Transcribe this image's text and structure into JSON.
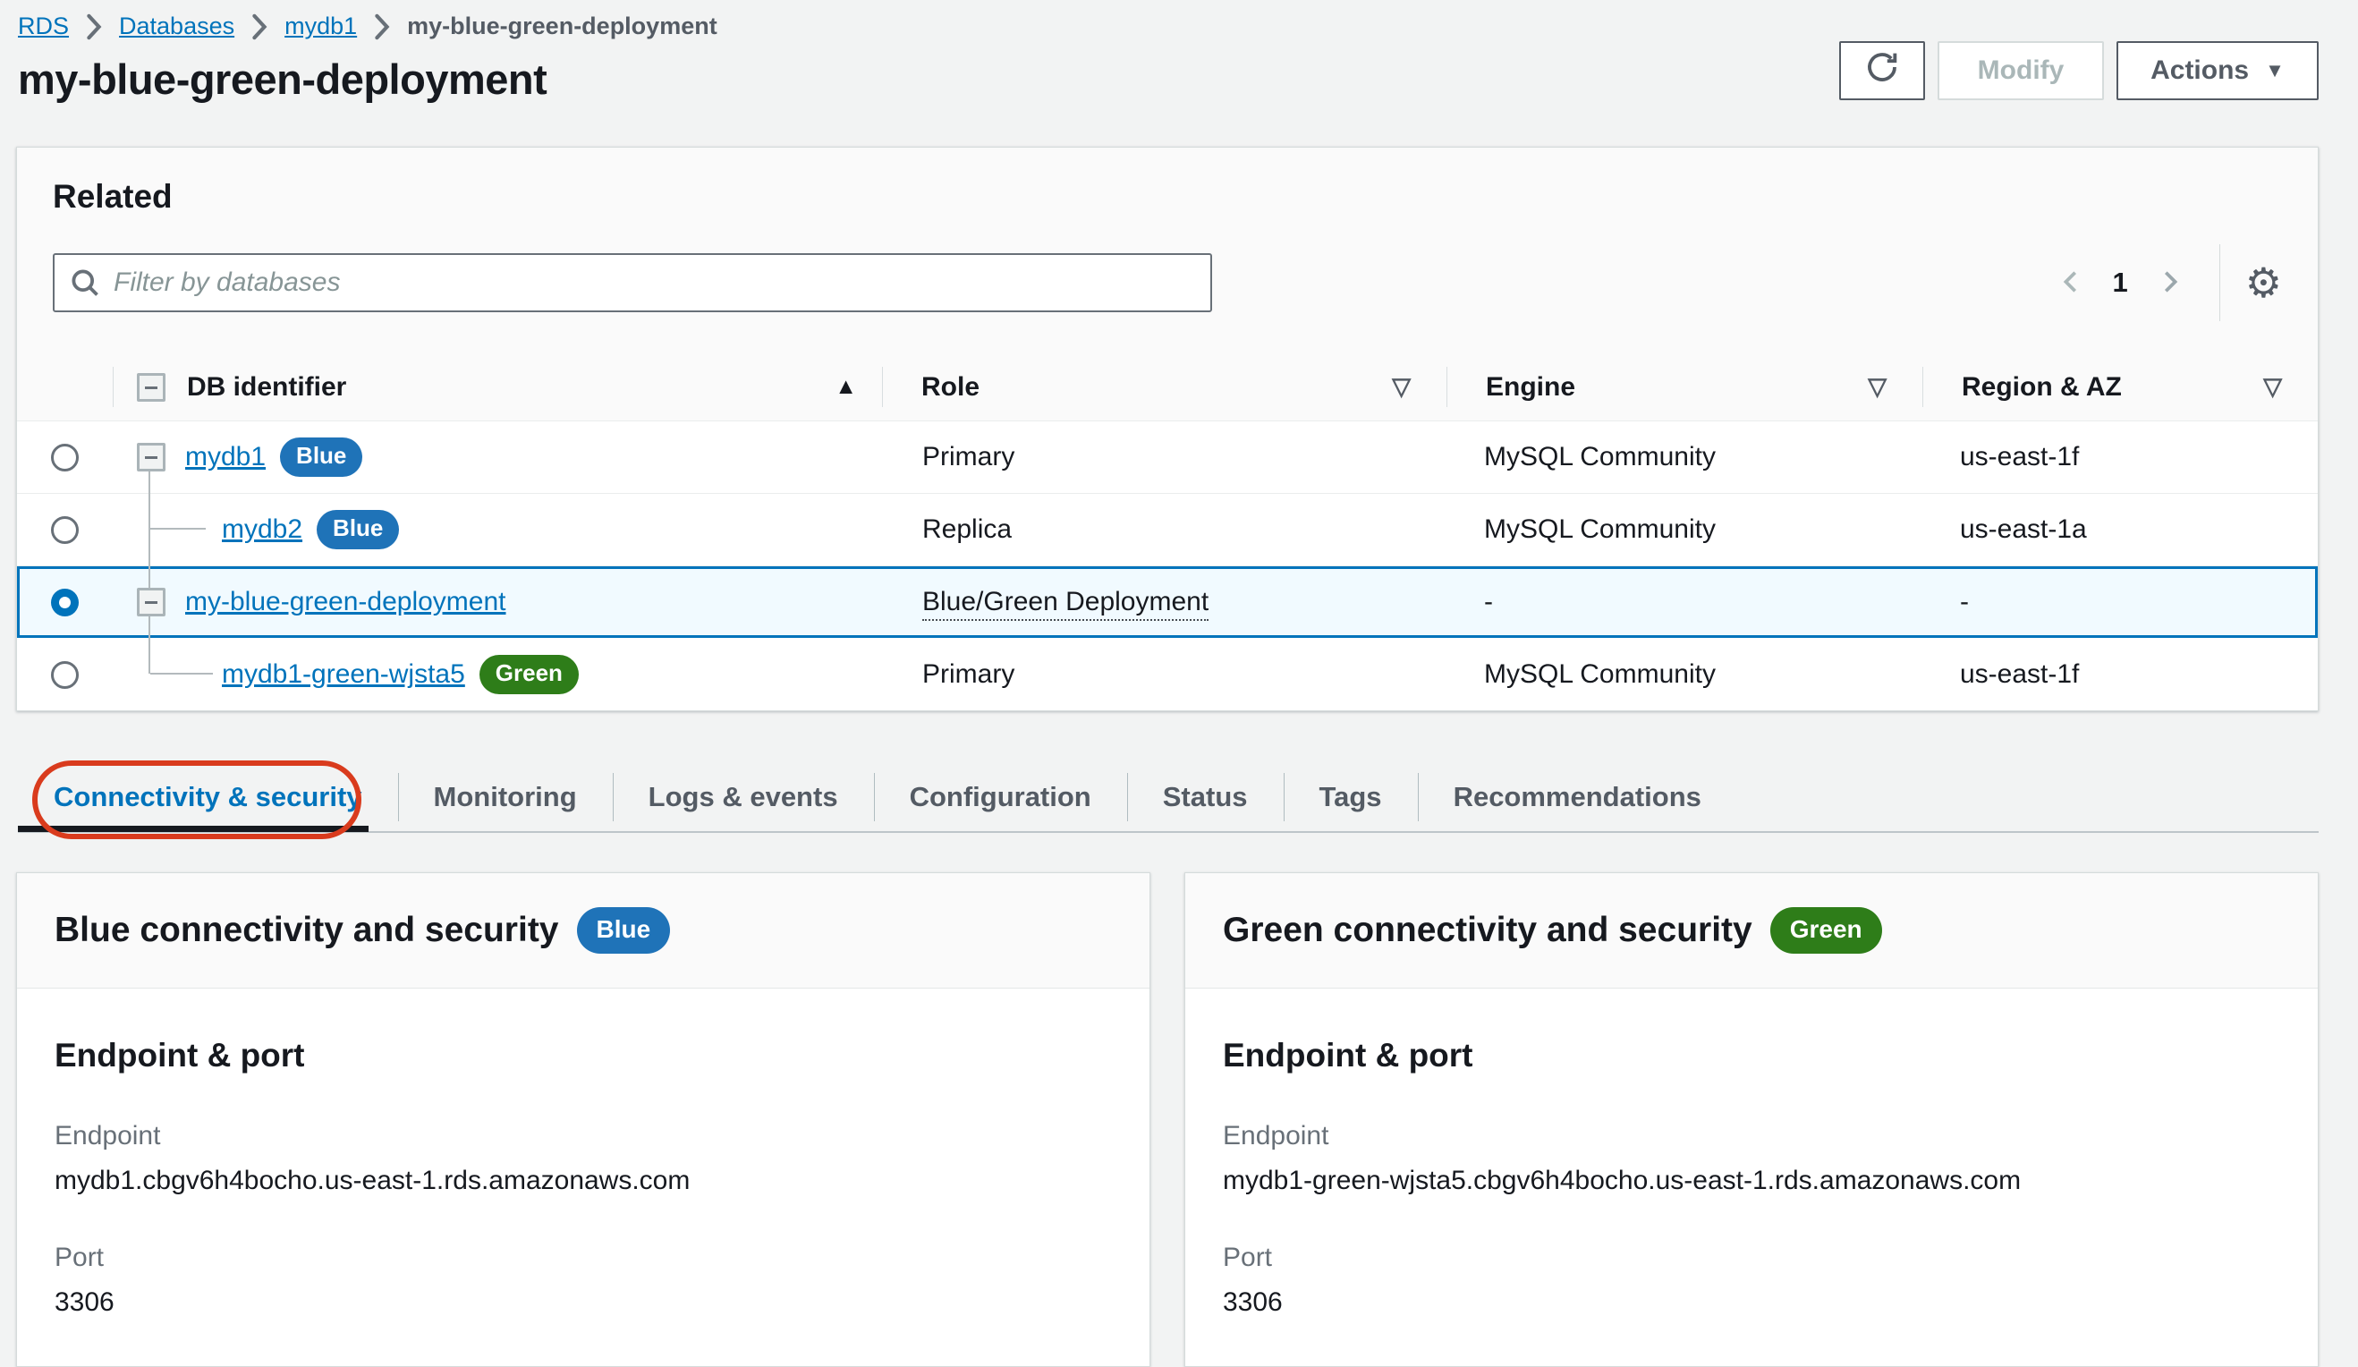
{
  "breadcrumb": {
    "items": [
      {
        "label": "RDS"
      },
      {
        "label": "Databases"
      },
      {
        "label": "mydb1"
      },
      {
        "label": "my-blue-green-deployment"
      }
    ]
  },
  "page": {
    "title": "my-blue-green-deployment"
  },
  "toolbar": {
    "modify_label": "Modify",
    "actions_label": "Actions"
  },
  "related": {
    "heading": "Related",
    "filter_placeholder": "Filter by databases",
    "pagination": {
      "current_page": "1"
    },
    "table": {
      "columns": [
        "DB identifier",
        "Role",
        "Engine",
        "Region & AZ"
      ],
      "sort": {
        "column": "DB identifier",
        "direction": "ascending"
      },
      "rows": [
        {
          "id": "mydb1",
          "badge": "Blue",
          "role": "Primary",
          "engine": "MySQL Community",
          "region_az": "us-east-1f",
          "selected": false
        },
        {
          "id": "mydb2",
          "badge": "Blue",
          "role": "Replica",
          "engine": "MySQL Community",
          "region_az": "us-east-1a",
          "selected": false
        },
        {
          "id": "my-blue-green-deployment",
          "badge": "",
          "role": "Blue/Green Deployment",
          "engine": "-",
          "region_az": "-",
          "selected": true
        },
        {
          "id": "mydb1-green-wjsta5",
          "badge": "Green",
          "role": "Primary",
          "engine": "MySQL Community",
          "region_az": "us-east-1f",
          "selected": false
        }
      ]
    }
  },
  "tabs": [
    {
      "label": "Connectivity & security",
      "active": true,
      "annotated": true
    },
    {
      "label": "Monitoring"
    },
    {
      "label": "Logs & events"
    },
    {
      "label": "Configuration"
    },
    {
      "label": "Status"
    },
    {
      "label": "Tags"
    },
    {
      "label": "Recommendations"
    }
  ],
  "panels": {
    "blue": {
      "title": "Blue connectivity and security",
      "badge": "Blue",
      "section_heading": "Endpoint & port",
      "endpoint_label": "Endpoint",
      "endpoint_value": "mydb1.cbgv6h4bocho.us-east-1.rds.amazonaws.com",
      "port_label": "Port",
      "port_value": "3306"
    },
    "green": {
      "title": "Green connectivity and security",
      "badge": "Green",
      "section_heading": "Endpoint & port",
      "endpoint_label": "Endpoint",
      "endpoint_value": "mydb1-green-wjsta5.cbgv6h4bocho.us-east-1.rds.amazonaws.com",
      "port_label": "Port",
      "port_value": "3306"
    }
  },
  "icons": {
    "gear": "⚙",
    "caret_down": "▼",
    "sort_ascending": "▲",
    "filter_column": "▽"
  },
  "colors": {
    "page_background": "#f2f3f3",
    "link_blue": "#0073bb",
    "badge_blue": "#1f73b8",
    "badge_green": "#2e7d19",
    "selected_row_bg": "#f1faff",
    "selected_row_border": "#0073bb",
    "active_tab_text": "#0073bb",
    "active_tab_underline": "#16191f",
    "annotation_red": "#d93b1d"
  }
}
